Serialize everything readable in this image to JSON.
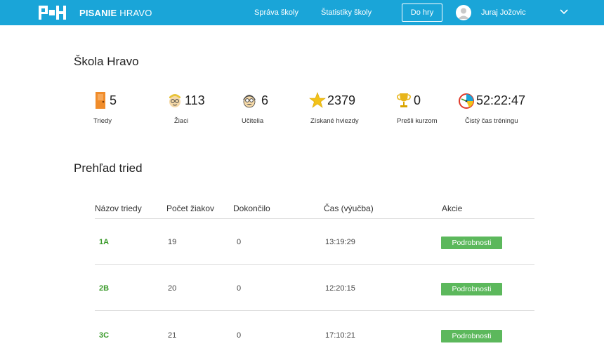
{
  "header": {
    "brand_bold": "PISANIE",
    "brand_light": "HRAVO",
    "nav": [
      {
        "label": "Správa školy"
      },
      {
        "label": "Štatistiky školy"
      }
    ],
    "play_label": "Do hry",
    "user_name": "Juraj Jožovic",
    "colors": {
      "bar": "#1aa5d8",
      "accent_green": "#5cb85c",
      "link_green": "#3a9a2a"
    }
  },
  "page": {
    "title": "Škola Hravo",
    "stats": [
      {
        "icon": "door-icon",
        "value": "5",
        "label": "Triedy"
      },
      {
        "icon": "student-icon",
        "value": "113",
        "label": "Žiaci"
      },
      {
        "icon": "teacher-icon",
        "value": "6",
        "label": "Učitelia"
      },
      {
        "icon": "star-icon",
        "value": "2379",
        "label": "Získané hviezdy"
      },
      {
        "icon": "trophy-icon",
        "value": "0",
        "label": "Prešli kurzom"
      },
      {
        "icon": "clock-icon",
        "value": "52:22:47",
        "label": "Čistý čas tréningu"
      }
    ]
  },
  "overview": {
    "title": "Prehľad tried",
    "columns": [
      "Názov triedy",
      "Počet žiakov",
      "Dokončilo",
      "Čas (výučba)",
      "Akcie"
    ],
    "rows": [
      {
        "name": "1A",
        "students": "19",
        "completed": "0",
        "time": "13:19:29",
        "action": "Podrobnosti"
      },
      {
        "name": "2B",
        "students": "20",
        "completed": "0",
        "time": "12:20:15",
        "action": "Podrobnosti"
      },
      {
        "name": "3C",
        "students": "21",
        "completed": "0",
        "time": "17:10:21",
        "action": "Podrobnosti"
      }
    ]
  }
}
